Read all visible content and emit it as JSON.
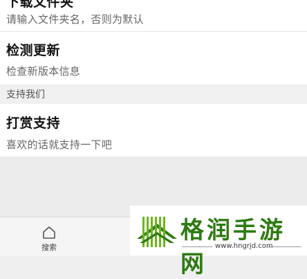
{
  "settings": {
    "folder_item": {
      "title": "下载文件夹",
      "subtitle": "请输入文件夹名，否则为默认"
    },
    "update_item": {
      "title": "检测更新",
      "subtitle": "检查新版本信息"
    },
    "support_section": {
      "header": "支持我们"
    },
    "donate_item": {
      "title": "打赏支持",
      "subtitle": "喜欢的话就支持一下吧"
    }
  },
  "bottom_nav": {
    "search_label": "搜索",
    "search_icon": "home-icon"
  },
  "watermark": {
    "name": "格润手游网",
    "url": "www.hngrjd.com",
    "accent_color": "#2f7a12"
  }
}
